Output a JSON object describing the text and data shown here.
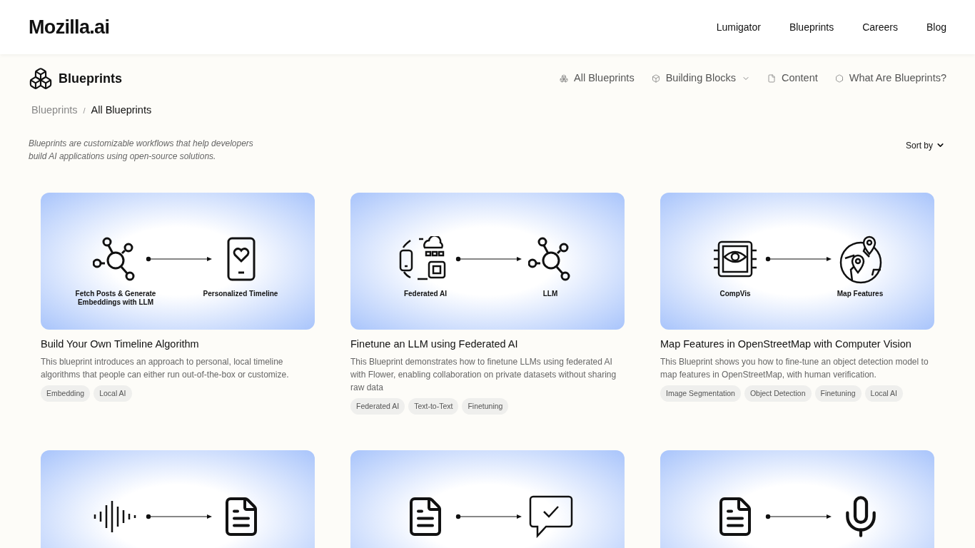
{
  "header": {
    "logo": "Mozilla.ai",
    "nav": [
      "Lumigator",
      "Blueprints",
      "Careers",
      "Blog"
    ]
  },
  "subheader": {
    "title": "Blueprints",
    "nav": [
      {
        "label": "All Blueprints",
        "kind": "boxes",
        "dropdown": false
      },
      {
        "label": "Building Blocks",
        "kind": "cube",
        "dropdown": true
      },
      {
        "label": "Content",
        "kind": "doc",
        "dropdown": false
      },
      {
        "label": "What Are Blueprints?",
        "kind": "hexes",
        "dropdown": false
      }
    ]
  },
  "breadcrumb": {
    "items": [
      "Blueprints",
      "All Blueprints"
    ],
    "separator": "/"
  },
  "description": "Blueprints are customizable workflows that help developers build AI applications using open-source solutions.",
  "sort": {
    "label": "Sort by"
  },
  "cards": [
    {
      "diagram": {
        "from": {
          "kind": "network",
          "label": "Fetch Posts & Generate Embeddings with LLM"
        },
        "to": {
          "kind": "phone-heart",
          "label": "Personalized Timeline"
        }
      },
      "title": "Build Your Own Timeline Algorithm",
      "text": "This blueprint introduces an approach to personal, local timeline algorithms that people can either run out-of-the-box or customize.",
      "tags": [
        "Embedding",
        "Local AI"
      ]
    },
    {
      "diagram": {
        "from": {
          "kind": "federated",
          "label": "Federated AI"
        },
        "to": {
          "kind": "network",
          "label": "LLM"
        }
      },
      "title": "Finetune an LLM using Federated AI",
      "text": "This Blueprint demonstrates how to finetune LLMs using federated AI with Flower, enabling collaboration on private datasets without sharing raw data",
      "tags": [
        "Federated AI",
        "Text-to-Text",
        "Finetuning"
      ]
    },
    {
      "diagram": {
        "from": {
          "kind": "chip-eye",
          "label": "CompVis"
        },
        "to": {
          "kind": "globe-pins",
          "label": "Map Features"
        }
      },
      "title": "Map Features in OpenStreetMap with Computer Vision",
      "text": "This Blueprint shows you how to fine-tune an object detection model to map features in OpenStreetMap, with human verification.",
      "tags": [
        "Image Segmentation",
        "Object Detection",
        "Finetuning",
        "Local AI"
      ]
    },
    {
      "diagram": {
        "from": {
          "kind": "waveform"
        },
        "to": {
          "kind": "document"
        }
      }
    },
    {
      "diagram": {
        "from": {
          "kind": "document"
        },
        "to": {
          "kind": "chat-check"
        }
      }
    },
    {
      "diagram": {
        "from": {
          "kind": "document"
        },
        "to": {
          "kind": "microphone"
        }
      }
    }
  ]
}
